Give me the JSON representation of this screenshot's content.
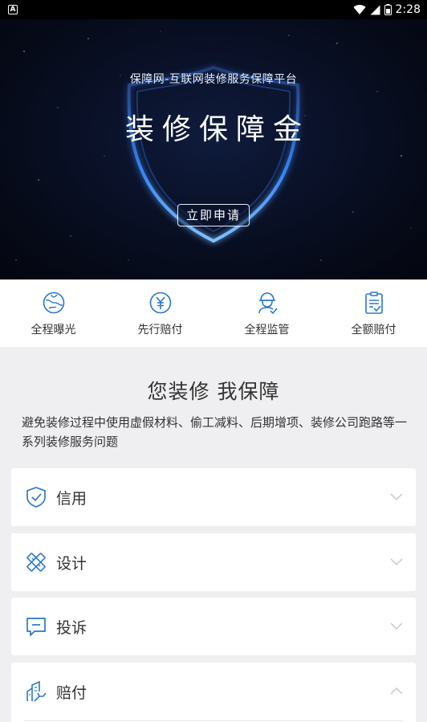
{
  "status_bar": {
    "notification_icon": "A",
    "time": "2:28",
    "icons": [
      "wifi-icon",
      "signal-icon",
      "battery-icon"
    ]
  },
  "hero": {
    "subtitle": "保障网-互联网装修服务保障平台",
    "title": "装修保障金",
    "apply_button": "立即申请",
    "glow_color": "#3a7bff"
  },
  "features": [
    {
      "label": "全程曝光",
      "icon": "globe-icon"
    },
    {
      "label": "先行赔付",
      "icon": "yen-coin-icon"
    },
    {
      "label": "全程监管",
      "icon": "worker-icon"
    },
    {
      "label": "全额赔付",
      "icon": "clipboard-check-icon"
    }
  ],
  "promise": {
    "title": "您装修 我保障",
    "description": "避免装修过程中使用虚假材料、偷工减料、后期增项、装修公司跑路等一系列装修服务问题"
  },
  "sections": [
    {
      "label": "信用",
      "icon": "shield-check-icon",
      "expanded": false
    },
    {
      "label": "设计",
      "icon": "ruler-pencil-icon",
      "expanded": false
    },
    {
      "label": "投诉",
      "icon": "chat-bubble-icon",
      "expanded": false
    },
    {
      "label": "赔付",
      "icon": "building-hand-icon",
      "expanded": true
    }
  ],
  "colors": {
    "accent": "#2a78c8",
    "icon_blue": "#2a78c8",
    "page_bg": "#efeff1",
    "chevron": "#c8c8c8"
  }
}
